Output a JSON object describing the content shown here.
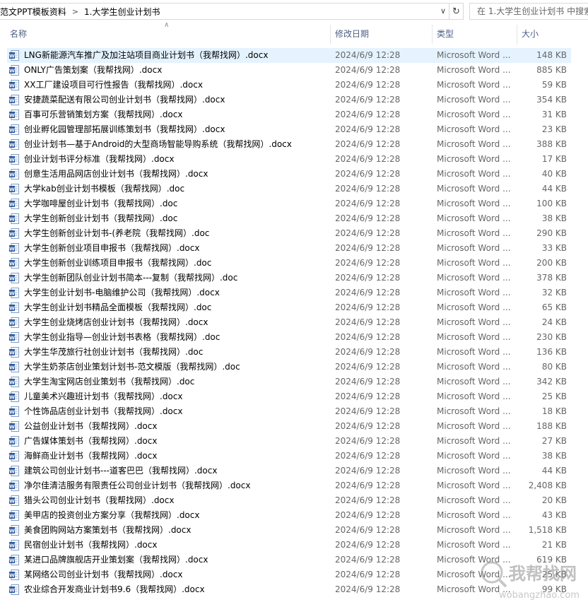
{
  "address_bar": {
    "crumbs": [
      "范文PPT模板资料",
      "1.大学生创业计划书"
    ],
    "search_placeholder": "在 1.大学生创业计划书 中搜索"
  },
  "columns": {
    "name": "名称",
    "date": "修改日期",
    "type": "类型",
    "size": "大小"
  },
  "files": [
    {
      "name": "LNG新能源汽车推广及加注站项目商业计划书（我帮找网）.docx",
      "date": "2024/6/9 12:28",
      "type": "Microsoft Word ...",
      "size": "148 KB"
    },
    {
      "name": "ONLY广告策划案（我帮找网）.docx",
      "date": "2024/6/9 12:28",
      "type": "Microsoft Word ...",
      "size": "885 KB"
    },
    {
      "name": "XX工厂建设项目可行性报告（我帮找网）.docx",
      "date": "2024/6/9 12:28",
      "type": "Microsoft Word ...",
      "size": "59 KB"
    },
    {
      "name": "安捷蔬菜配送有限公司创业计划书（我帮找网）.docx",
      "date": "2024/6/9 12:28",
      "type": "Microsoft Word ...",
      "size": "354 KB"
    },
    {
      "name": "百事可乐营销策划方案（我帮找网）.docx",
      "date": "2024/6/9 12:28",
      "type": "Microsoft Word ...",
      "size": "31 KB"
    },
    {
      "name": "创业孵化园管理部拓展训练策划书（我帮找网）.docx",
      "date": "2024/6/9 12:28",
      "type": "Microsoft Word ...",
      "size": "23 KB"
    },
    {
      "name": "创业计划书—基于Android的大型商场智能导购系统（我帮找网）.docx",
      "date": "2024/6/9 12:28",
      "type": "Microsoft Word ...",
      "size": "388 KB"
    },
    {
      "name": "创业计划书评分标准（我帮找网）.docx",
      "date": "2024/6/9 12:28",
      "type": "Microsoft Word ...",
      "size": "17 KB"
    },
    {
      "name": "创意生活用品网店创业计划书（我帮找网）.docx",
      "date": "2024/6/9 12:28",
      "type": "Microsoft Word ...",
      "size": "40 KB"
    },
    {
      "name": "大学kab创业计划书模板（我帮找网）.doc",
      "date": "2024/6/9 12:28",
      "type": "Microsoft Word ...",
      "size": "44 KB"
    },
    {
      "name": "大学咖啡屋创业计划书（我帮找网）.doc",
      "date": "2024/6/9 12:28",
      "type": "Microsoft Word ...",
      "size": "100 KB"
    },
    {
      "name": "大学生创新创业计划书（我帮找网）.doc",
      "date": "2024/6/9 12:28",
      "type": "Microsoft Word ...",
      "size": "38 KB"
    },
    {
      "name": "大学生创新创业计划书-(养老院（我帮找网）.doc",
      "date": "2024/6/9 12:28",
      "type": "Microsoft Word ...",
      "size": "290 KB"
    },
    {
      "name": "大学生创新创业项目申报书（我帮找网）.docx",
      "date": "2024/6/9 12:28",
      "type": "Microsoft Word ...",
      "size": "33 KB"
    },
    {
      "name": "大学生创新创业训练项目申报书（我帮找网）.doc",
      "date": "2024/6/9 12:28",
      "type": "Microsoft Word ...",
      "size": "200 KB"
    },
    {
      "name": "大学生创新团队创业计划书简本---复制（我帮找网）.doc",
      "date": "2024/6/9 12:28",
      "type": "Microsoft Word ...",
      "size": "378 KB"
    },
    {
      "name": "大学生创业计划书-电脑维护公司（我帮找网）.docx",
      "date": "2024/6/9 12:28",
      "type": "Microsoft Word ...",
      "size": "32 KB"
    },
    {
      "name": "大学生创业计划书精品全面模板（我帮找网）.doc",
      "date": "2024/6/9 12:28",
      "type": "Microsoft Word ...",
      "size": "65 KB"
    },
    {
      "name": "大学生创业烧烤店创业计划书（我帮找网）.docx",
      "date": "2024/6/9 12:28",
      "type": "Microsoft Word ...",
      "size": "24 KB"
    },
    {
      "name": "大学生创业指导—创业计划书表格（我帮找网）.doc",
      "date": "2024/6/9 12:28",
      "type": "Microsoft Word ...",
      "size": "230 KB"
    },
    {
      "name": "大学生华茂旅行社创业计划书（我帮找网）.doc",
      "date": "2024/6/9 12:28",
      "type": "Microsoft Word ...",
      "size": "136 KB"
    },
    {
      "name": "大学生奶茶店创业策划计划书-范文模版（我帮找网）.doc",
      "date": "2024/6/9 12:28",
      "type": "Microsoft Word ...",
      "size": "80 KB"
    },
    {
      "name": "大学生淘宝网店创业策划书（我帮找网）.doc",
      "date": "2024/6/9 12:28",
      "type": "Microsoft Word ...",
      "size": "342 KB"
    },
    {
      "name": "儿童美术兴趣班计划书（我帮找网）.docx",
      "date": "2024/6/9 12:28",
      "type": "Microsoft Word ...",
      "size": "25 KB"
    },
    {
      "name": "个性饰品店创业计划书（我帮找网）.docx",
      "date": "2024/6/9 12:28",
      "type": "Microsoft Word ...",
      "size": "18 KB"
    },
    {
      "name": "公益创业计划书（我帮找网）.docx",
      "date": "2024/6/9 12:28",
      "type": "Microsoft Word ...",
      "size": "188 KB"
    },
    {
      "name": "广告媒体策划书（我帮找网）.docx",
      "date": "2024/6/9 12:28",
      "type": "Microsoft Word ...",
      "size": "27 KB"
    },
    {
      "name": "海鲜商业计划书（我帮找网）.docx",
      "date": "2024/6/9 12:28",
      "type": "Microsoft Word ...",
      "size": "38 KB"
    },
    {
      "name": "建筑公司创业计划书---道客巴巴（我帮找网）.docx",
      "date": "2024/6/9 12:28",
      "type": "Microsoft Word ...",
      "size": "44 KB"
    },
    {
      "name": "净尔佳清洁服务有限责任公司创业计划书（我帮找网）.docx",
      "date": "2024/6/9 12:28",
      "type": "Microsoft Word ...",
      "size": "2,408 KB"
    },
    {
      "name": "猎头公司创业计划书（我帮找网）.docx",
      "date": "2024/6/9 12:28",
      "type": "Microsoft Word ...",
      "size": "20 KB"
    },
    {
      "name": "美甲店的投资创业方案分享（我帮找网）.docx",
      "date": "2024/6/9 12:28",
      "type": "Microsoft Word ...",
      "size": "43 KB"
    },
    {
      "name": "美食团购网站方案策划书（我帮找网）.docx",
      "date": "2024/6/9 12:28",
      "type": "Microsoft Word ...",
      "size": "1,518 KB"
    },
    {
      "name": "民宿创业计划书（我帮找网）.docx",
      "date": "2024/6/9 12:28",
      "type": "Microsoft Word ...",
      "size": "21 KB"
    },
    {
      "name": "某进口品牌旗舰店开业策划案（我帮找网）.docx",
      "date": "2024/6/9 12:28",
      "type": "Microsoft Word ...",
      "size": "619 KB"
    },
    {
      "name": "某网络公司创业计划书（我帮找网）.docx",
      "date": "2024/6/9 12:28",
      "type": "Microsoft Word ...",
      "size": "25 KB"
    },
    {
      "name": "农业综合开发商业计划书9.6（我帮找网）.docx",
      "date": "2024/6/9 12:28",
      "type": "Microsoft Word ...",
      "size": "99 KB"
    }
  ],
  "watermark": {
    "text": "我帮找网",
    "url": "wobangzhao.com"
  },
  "colors": {
    "header_text": "#4d6082",
    "selected_row": "#e5f3ff",
    "word_icon": "#2b579a"
  }
}
